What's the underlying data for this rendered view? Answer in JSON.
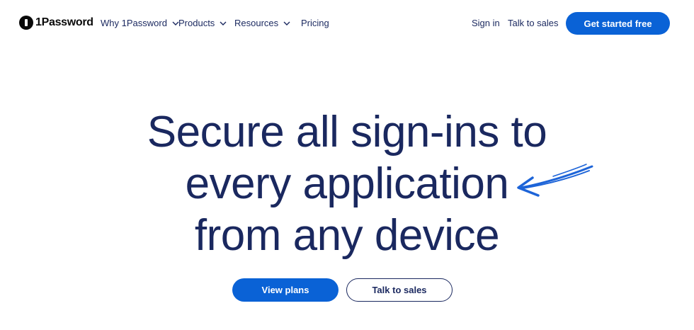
{
  "brand": {
    "name": "1Password",
    "logo_icon": "1password-logo-icon"
  },
  "nav": {
    "items": [
      {
        "label": "Why 1Password",
        "has_dropdown": true
      },
      {
        "label": "Products",
        "has_dropdown": true
      },
      {
        "label": "Resources",
        "has_dropdown": true
      },
      {
        "label": "Pricing",
        "has_dropdown": false
      }
    ],
    "sign_in": "Sign in",
    "talk_to_sales": "Talk to sales",
    "get_started": "Get started free"
  },
  "hero": {
    "lines": [
      "Secure all sign-ins to",
      "every application",
      "from any device"
    ],
    "primary_cta": "View plans",
    "secondary_cta": "Talk to sales"
  },
  "colors": {
    "primary": "#0a62d6",
    "text": "#1a285f",
    "background": "#ffffff"
  }
}
